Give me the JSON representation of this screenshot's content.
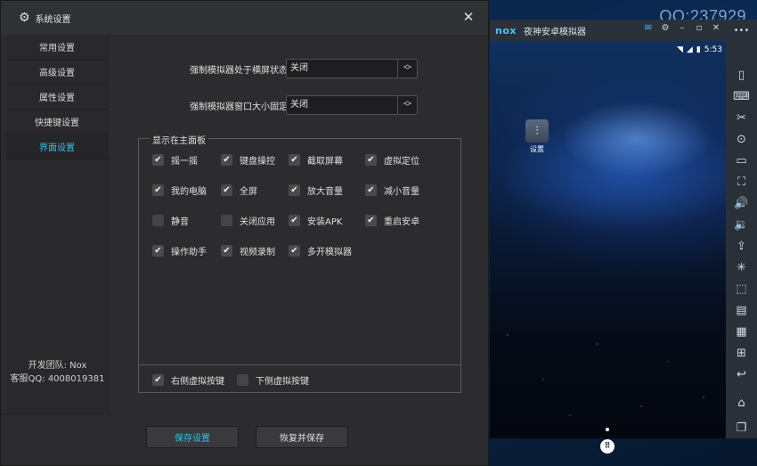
{
  "desktop": {
    "watermark": "QQ:237929"
  },
  "emulator": {
    "logo": "nox",
    "title": "夜神安卓模拟器",
    "title_controls": [
      "mail-icon",
      "gear-icon",
      "minimize-icon",
      "restore-icon",
      "close-icon"
    ],
    "status": {
      "time": "5:53"
    },
    "home_app": {
      "label": "设置",
      "icon": "settings-app-icon"
    },
    "side_toolbar": [
      "more-icon",
      "shake-icon",
      "keyboard-icon",
      "scissors-icon",
      "location-icon",
      "screen-icon",
      "fullscreen-icon",
      "volume-up-icon",
      "volume-down-icon",
      "apk-install-icon",
      "loading-icon",
      "screenshot-icon",
      "multi-open-icon",
      "video-icon",
      "operation-icon",
      "back-icon",
      "home-icon",
      "recents-icon"
    ]
  },
  "dialog": {
    "title": "系统设置",
    "nav": [
      {
        "label": "常用设置",
        "active": false
      },
      {
        "label": "高级设置",
        "active": false
      },
      {
        "label": "属性设置",
        "active": false
      },
      {
        "label": "快捷键设置",
        "active": false
      },
      {
        "label": "界面设置",
        "active": true
      }
    ],
    "footer_team": "开发团队: Nox",
    "footer_qq": "客服QQ: 4008019381",
    "settings": {
      "landscape_label": "强制模拟器处于横屏状态",
      "landscape_value": "关闭",
      "fixed_size_label": "强制模拟器窗口大小固定",
      "fixed_size_value": "关闭"
    },
    "panel_group": {
      "legend": "显示在主面板",
      "items": [
        {
          "label": "摇一摇",
          "checked": true
        },
        {
          "label": "键盘操控",
          "checked": true
        },
        {
          "label": "截取屏幕",
          "checked": true
        },
        {
          "label": "虚拟定位",
          "checked": true
        },
        {
          "label": "我的电脑",
          "checked": true
        },
        {
          "label": "全屏",
          "checked": true
        },
        {
          "label": "放大音量",
          "checked": true
        },
        {
          "label": "减小音量",
          "checked": true
        },
        {
          "label": "静音",
          "checked": false
        },
        {
          "label": "关闭应用",
          "checked": false
        },
        {
          "label": "安装APK",
          "checked": true
        },
        {
          "label": "重启安卓",
          "checked": true
        },
        {
          "label": "操作助手",
          "checked": true
        },
        {
          "label": "视频录制",
          "checked": true
        },
        {
          "label": "多开模拟器",
          "checked": true
        }
      ],
      "virtual_keys": [
        {
          "label": "右侧虚拟按键",
          "checked": true
        },
        {
          "label": "下侧虚拟按键",
          "checked": false
        }
      ]
    },
    "buttons": {
      "save": "保存设置",
      "restore": "恢复并保存"
    }
  }
}
